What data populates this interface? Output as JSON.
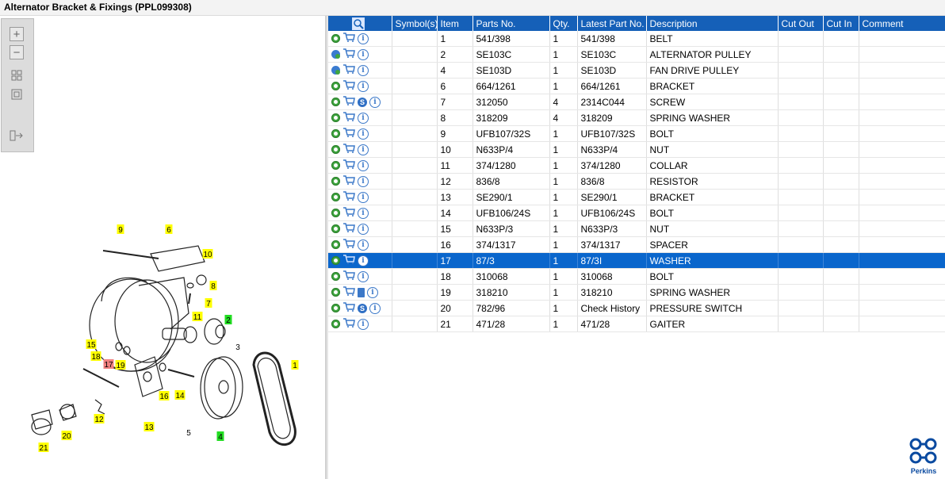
{
  "window": {
    "title": "Alternator Bracket & Fixings (PPL099308)"
  },
  "columns": [
    "Symbol(s)",
    "Item",
    "Parts No.",
    "Qty.",
    "Latest Part No.",
    "Description",
    "Cut Out",
    "Cut In",
    "Comment"
  ],
  "rows": [
    {
      "icons": [
        "gear",
        "cart",
        "info"
      ],
      "item": "1",
      "part": "541/398",
      "qty": "1",
      "latest": "541/398",
      "desc": "BELT"
    },
    {
      "icons": [
        "gearb",
        "cart",
        "info"
      ],
      "item": "2",
      "part": "SE103C",
      "qty": "1",
      "latest": "SE103C",
      "desc": "ALTERNATOR PULLEY"
    },
    {
      "icons": [
        "gearb",
        "cart",
        "info"
      ],
      "item": "4",
      "part": "SE103D",
      "qty": "1",
      "latest": "SE103D",
      "desc": "FAN DRIVE PULLEY"
    },
    {
      "icons": [
        "gear",
        "cart",
        "info"
      ],
      "item": "6",
      "part": "664/1261",
      "qty": "1",
      "latest": "664/1261",
      "desc": "BRACKET"
    },
    {
      "icons": [
        "gear",
        "cart",
        "s",
        "info"
      ],
      "item": "7",
      "part": "312050",
      "qty": "4",
      "latest": "2314C044",
      "desc": "SCREW"
    },
    {
      "icons": [
        "gear",
        "cart",
        "info"
      ],
      "item": "8",
      "part": "318209",
      "qty": "4",
      "latest": "318209",
      "desc": "SPRING WASHER"
    },
    {
      "icons": [
        "gear",
        "cart",
        "info"
      ],
      "item": "9",
      "part": "UFB107/32S",
      "qty": "1",
      "latest": "UFB107/32S",
      "desc": "BOLT"
    },
    {
      "icons": [
        "gear",
        "cart",
        "info"
      ],
      "item": "10",
      "part": "N633P/4",
      "qty": "1",
      "latest": "N633P/4",
      "desc": "NUT"
    },
    {
      "icons": [
        "gear",
        "cart",
        "info"
      ],
      "item": "11",
      "part": "374/1280",
      "qty": "1",
      "latest": "374/1280",
      "desc": "COLLAR"
    },
    {
      "icons": [
        "gear",
        "cart",
        "info"
      ],
      "item": "12",
      "part": "836/8",
      "qty": "1",
      "latest": "836/8",
      "desc": "RESISTOR"
    },
    {
      "icons": [
        "gear",
        "cart",
        "info"
      ],
      "item": "13",
      "part": "SE290/1",
      "qty": "1",
      "latest": "SE290/1",
      "desc": "BRACKET"
    },
    {
      "icons": [
        "gear",
        "cart",
        "info"
      ],
      "item": "14",
      "part": "UFB106/24S",
      "qty": "1",
      "latest": "UFB106/24S",
      "desc": "BOLT"
    },
    {
      "icons": [
        "gear",
        "cart",
        "info"
      ],
      "item": "15",
      "part": "N633P/3",
      "qty": "1",
      "latest": "N633P/3",
      "desc": "NUT"
    },
    {
      "icons": [
        "gear",
        "cart",
        "info"
      ],
      "item": "16",
      "part": "374/1317",
      "qty": "1",
      "latest": "374/1317",
      "desc": "SPACER"
    },
    {
      "icons": [
        "gear",
        "cart",
        "info"
      ],
      "item": "17",
      "part": "87/3",
      "qty": "1",
      "latest": "87/3I",
      "desc": "WASHER",
      "selected": true
    },
    {
      "icons": [
        "gear",
        "cart",
        "info"
      ],
      "item": "18",
      "part": "310068",
      "qty": "1",
      "latest": "310068",
      "desc": "BOLT"
    },
    {
      "icons": [
        "gear",
        "cart",
        "doc",
        "info"
      ],
      "item": "19",
      "part": "318210",
      "qty": "1",
      "latest": "318210",
      "desc": "SPRING WASHER"
    },
    {
      "icons": [
        "gear",
        "cart",
        "s",
        "info"
      ],
      "item": "20",
      "part": "782/96",
      "qty": "1",
      "latest": "Check History",
      "desc": "PRESSURE SWITCH"
    },
    {
      "icons": [
        "gear",
        "cart",
        "info"
      ],
      "item": "21",
      "part": "471/28",
      "qty": "1",
      "latest": "471/28",
      "desc": "GAITER"
    }
  ],
  "diagram_callouts": [
    "9",
    "6",
    "10",
    "8",
    "7",
    "11",
    "2",
    "3",
    "15",
    "18",
    "17",
    "19",
    "16",
    "14",
    "1",
    "12",
    "13",
    "5",
    "4",
    "20",
    "21"
  ],
  "brand": {
    "name": "Perkins"
  },
  "colors": {
    "header": "#1560b8",
    "selected_row": "#0a66cc",
    "callout_yellow": "#ffff00",
    "callout_green": "#22dd22",
    "callout_red": "#f08080"
  }
}
